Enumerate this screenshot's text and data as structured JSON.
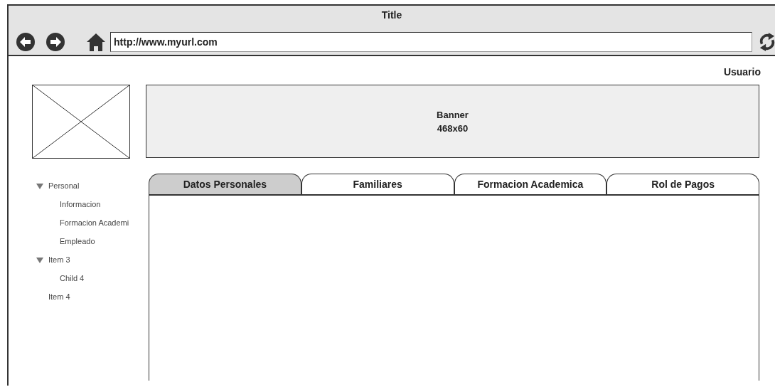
{
  "window": {
    "title": "Title"
  },
  "address_bar": {
    "value": "http://www.myurl.com"
  },
  "user_label": "Usuario",
  "banner": {
    "lines": [
      "Banner",
      "468x60"
    ]
  },
  "tree": [
    {
      "label": "Personal",
      "expanded": true,
      "children": [
        {
          "label": "Informacion"
        },
        {
          "label": "Formacion Academi"
        },
        {
          "label": "Empleado"
        }
      ]
    },
    {
      "label": "Item 3",
      "expanded": true,
      "children": [
        {
          "label": "Child 4"
        }
      ]
    },
    {
      "label": "Item 4"
    }
  ],
  "tabs": [
    {
      "label": "Datos Personales",
      "selected": true
    },
    {
      "label": "Familiares",
      "selected": false
    },
    {
      "label": "Formacion Academica",
      "selected": false
    },
    {
      "label": "Rol de Pagos",
      "selected": false
    }
  ]
}
